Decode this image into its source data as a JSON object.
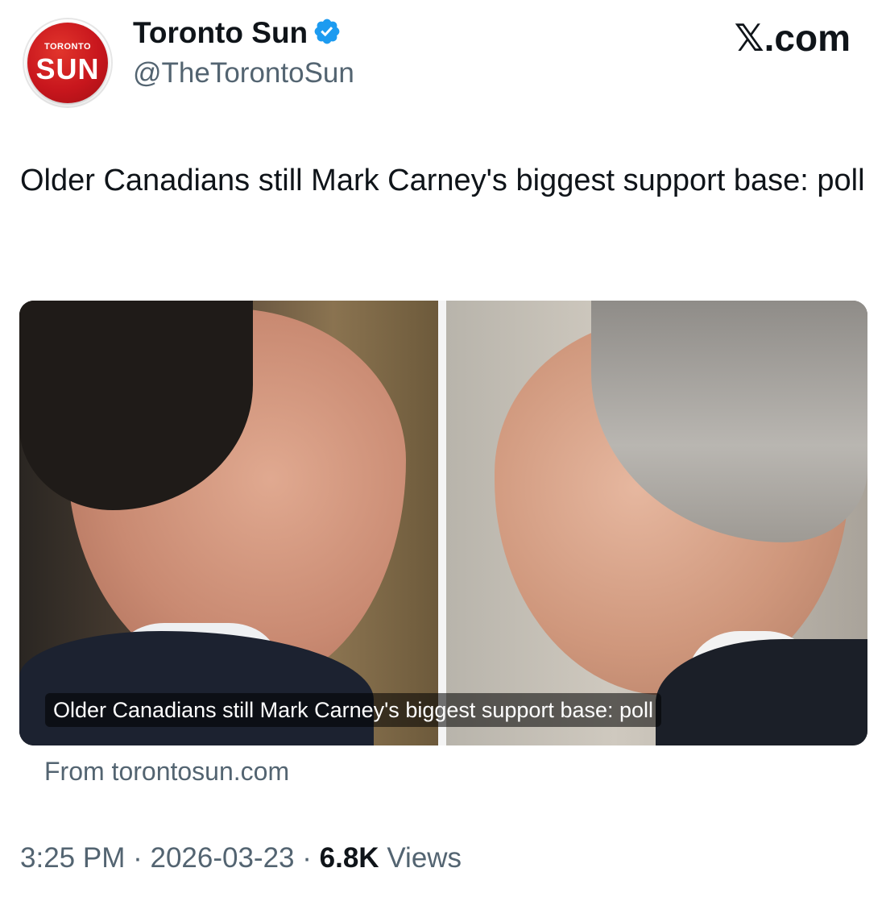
{
  "author": {
    "avatar_top": "TORONTO",
    "avatar_main": "SUN",
    "name": "Toronto Sun",
    "handle": "@TheTorontoSun",
    "verified_color": "#1d9bf0"
  },
  "platform": "𝕏.com",
  "tweet": {
    "text": "Older Canadians still Mark Carney's biggest support base: poll"
  },
  "link_card": {
    "caption": "Older Canadians still Mark Carney's biggest support base: poll",
    "source": "From torontosun.com"
  },
  "meta": {
    "time": "3:25 PM",
    "separator": "·",
    "date": "2026-03-23",
    "views_count": "6.8K",
    "views_label": "Views"
  },
  "colors": {
    "brand_red": "#c8161d",
    "secondary_text": "#536471"
  }
}
